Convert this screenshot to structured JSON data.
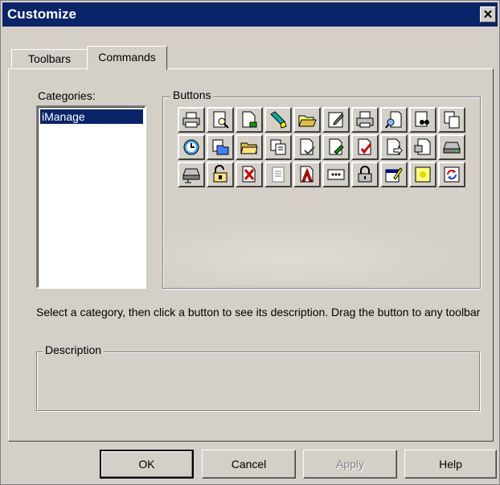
{
  "window": {
    "title": "Customize",
    "close_glyph": "✕"
  },
  "tabs": [
    {
      "label": "Toolbars",
      "active": false
    },
    {
      "label": "Commands",
      "active": true
    }
  ],
  "categories": {
    "label": "Categories:",
    "items": [
      "iManage"
    ],
    "selected": "iManage"
  },
  "buttons_group": {
    "label": "Buttons",
    "icons": [
      "printer-icon",
      "print-preview-icon",
      "new-document-icon",
      "highlighter-icon",
      "open-folder-icon",
      "edit-document-icon",
      "print-icon",
      "search-document-icon",
      "find-binoculars-icon",
      "copy-icon",
      "history-icon",
      "new-folder-icon",
      "browse-folder-icon",
      "copy-pages-icon",
      "document-check-icon",
      "document-edit-icon",
      "checkout-icon",
      "forward-document-icon",
      "export-document-icon",
      "network-drive-icon",
      "connect-drive-icon",
      "lock-open-icon",
      "delete-document-icon",
      "notepad-icon",
      "acrobat-icon",
      "ellipsis-box-icon",
      "padlock-icon",
      "edit-profile-icon",
      "yellow-note-icon",
      "refresh-sync-icon"
    ]
  },
  "hint_text": "Select a category, then click a button to see its description. Drag the button to any toolbar",
  "description": {
    "label": "Description",
    "text": ""
  },
  "footer": {
    "ok": "OK",
    "cancel": "Cancel",
    "apply": "Apply",
    "help": "Help"
  },
  "colors": {
    "titlebar": "#0a246a",
    "dialog_face": "#d4d0c8",
    "selection": "#0a246a"
  }
}
